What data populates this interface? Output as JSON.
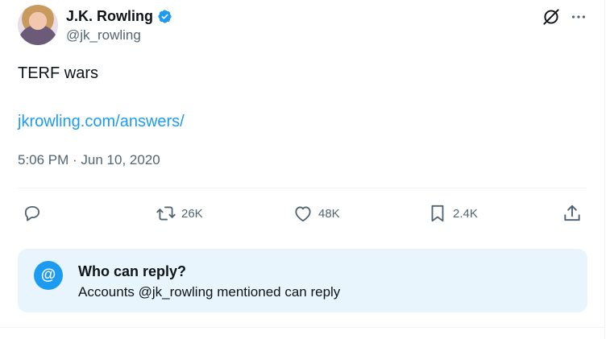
{
  "author": {
    "name": "J.K. Rowling",
    "handle": "@jk_rowling",
    "verified_icon": "verified-badge-icon"
  },
  "header_icons": {
    "grok": "grok-icon",
    "more": "more-options-icon"
  },
  "tweet": {
    "text": "TERF wars",
    "link": "jkrowling.com/answers/",
    "timestamp": "5:06 PM · Jun 10, 2020"
  },
  "actions": {
    "reply": {
      "icon": "reply-icon",
      "count": ""
    },
    "repost": {
      "icon": "repost-icon",
      "count": "26K"
    },
    "like": {
      "icon": "heart-icon",
      "count": "48K"
    },
    "bookmark": {
      "icon": "bookmark-icon",
      "count": "2.4K"
    },
    "share": {
      "icon": "share-icon"
    }
  },
  "reply_restriction": {
    "icon_glyph": "@",
    "title": "Who can reply?",
    "subtitle": "Accounts @jk_rowling mentioned can reply"
  },
  "colors": {
    "accent": "#1d9bf0",
    "muted": "#536471",
    "text": "#0f1419",
    "reply_box_bg": "#e8f5fd"
  }
}
